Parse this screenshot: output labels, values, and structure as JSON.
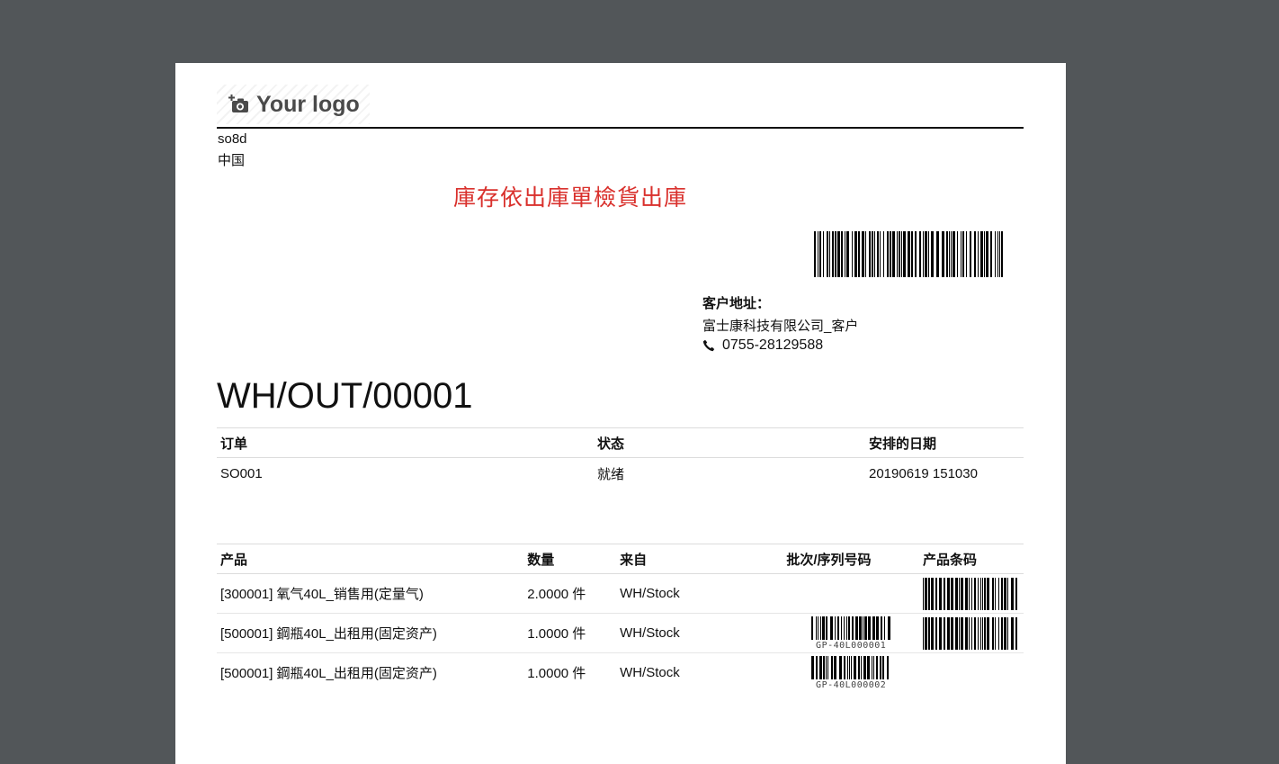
{
  "logo": {
    "text": "Your logo",
    "icon": "camera-add-icon"
  },
  "company": {
    "name": "so8d",
    "country": "中国"
  },
  "document": {
    "subtitle": "庫存依出庫單檢貨出庫",
    "reference": "WH/OUT/00001"
  },
  "customer": {
    "label": "客户地址：",
    "name": "富士康科技有限公司_客户",
    "phone": "0755-28129588",
    "phone_icon": "phone-icon"
  },
  "info_table": {
    "headers": {
      "order": "订单",
      "status": "状态",
      "scheduled_date": "安排的日期"
    },
    "row": {
      "order": "SO001",
      "status": "就绪",
      "scheduled_date": "20190619 151030"
    }
  },
  "moves_table": {
    "headers": {
      "product": "产品",
      "quantity": "数量",
      "from": "来自",
      "lot": "批次/序列号码",
      "barcode": "产品条码"
    },
    "rows": [
      {
        "product": "[300001] 氧气40L_销售用(定量气)",
        "quantity": "2.0000 件",
        "from": "WH/Stock",
        "lot": "",
        "has_barcode": true
      },
      {
        "product": "[500001] 鋼瓶40L_出租用(固定资产)",
        "quantity": "1.0000 件",
        "from": "WH/Stock",
        "lot": "GP-40L000001",
        "has_barcode": true
      },
      {
        "product": "[500001] 鋼瓶40L_出租用(固定资产)",
        "quantity": "1.0000 件",
        "from": "WH/Stock",
        "lot": "GP-40L000002",
        "has_barcode": false
      }
    ]
  }
}
